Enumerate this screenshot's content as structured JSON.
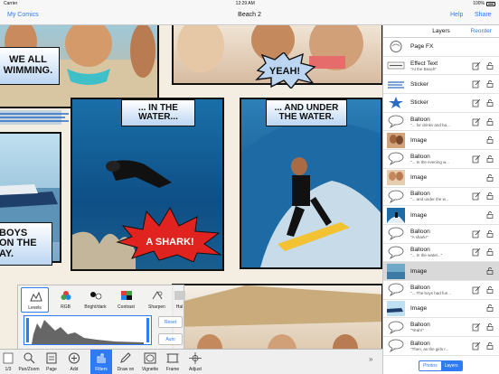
{
  "status": {
    "carrier": "Carrier",
    "time": "12:29 AM",
    "battery": "100%"
  },
  "nav": {
    "back": "My Comics",
    "title": "Beach 2",
    "help": "Help",
    "share": "Share"
  },
  "captions": {
    "top_left": "WE ALL\nWIMMING.",
    "yeah": "YEAH!",
    "in_the_water": "... IN THE\nWATER...",
    "and_under": "... AND UNDER\nTHE WATER.",
    "boys": "BOYS\nON THE\nAY.",
    "shark": "A SHARK!"
  },
  "layers": {
    "title": "Layers",
    "reorder": "Reorder",
    "items": [
      {
        "name": "Page FX",
        "sub": "",
        "thumb": "pagefx"
      },
      {
        "name": "Effect Text",
        "sub": "\"At the Beach\"",
        "thumb": "effect"
      },
      {
        "name": "Sticker",
        "sub": "",
        "thumb": "sticker1"
      },
      {
        "name": "Sticker",
        "sub": "",
        "thumb": "sticker2"
      },
      {
        "name": "Balloon",
        "sub": "\"... for drinks and ba...",
        "thumb": "balloon"
      },
      {
        "name": "Image",
        "sub": "",
        "thumb": "beach"
      },
      {
        "name": "Balloon",
        "sub": "\"... In the evening w...",
        "thumb": "balloon"
      },
      {
        "name": "Image",
        "sub": "",
        "thumb": "people"
      },
      {
        "name": "Balloon",
        "sub": "\"... and under the w...",
        "thumb": "balloon"
      },
      {
        "name": "Image",
        "sub": "",
        "thumb": "surf"
      },
      {
        "name": "Balloon",
        "sub": "\"A shark!\"",
        "thumb": "balloon"
      },
      {
        "name": "Balloon",
        "sub": "\"... In the water...\"",
        "thumb": "balloon"
      },
      {
        "name": "Image",
        "sub": "",
        "thumb": "water"
      },
      {
        "name": "Balloon",
        "sub": "\"... The boys had fun...",
        "thumb": "balloon"
      },
      {
        "name": "Image",
        "sub": "",
        "thumb": "boat"
      },
      {
        "name": "Balloon",
        "sub": "\"Yeah!\"",
        "thumb": "balloon"
      },
      {
        "name": "Balloon",
        "sub": "\"Then, as the girls r...",
        "thumb": "balloon"
      }
    ],
    "selected_index": 12
  },
  "segment": {
    "photos": "Photos",
    "layers": "Layers"
  },
  "toolbar": {
    "page_number": "1/3",
    "items": [
      {
        "label": "Pan/Zoom",
        "icon": "pan-zoom-icon"
      },
      {
        "label": "Page",
        "icon": "page-icon"
      },
      {
        "label": "Add",
        "icon": "add-icon"
      },
      {
        "label": "Filters",
        "icon": "filters-icon"
      },
      {
        "label": "Draw on",
        "icon": "pencil-icon"
      },
      {
        "label": "Vignette",
        "icon": "vignette-icon"
      },
      {
        "label": "Frame",
        "icon": "frame-icon"
      },
      {
        "label": "Adjust",
        "icon": "adjust-icon"
      }
    ]
  },
  "filters": {
    "items": [
      {
        "label": "Levels"
      },
      {
        "label": "RGB"
      },
      {
        "label": "Bright/dark"
      },
      {
        "label": "Contrast"
      },
      {
        "label": "Sharpen"
      },
      {
        "label": "Hal"
      }
    ],
    "reset": "Reset",
    "auto": "Auto"
  },
  "colors": {
    "accent": "#2f7bf5",
    "caption_fill": "#bcd6f2",
    "shark_red": "#e0231f"
  }
}
